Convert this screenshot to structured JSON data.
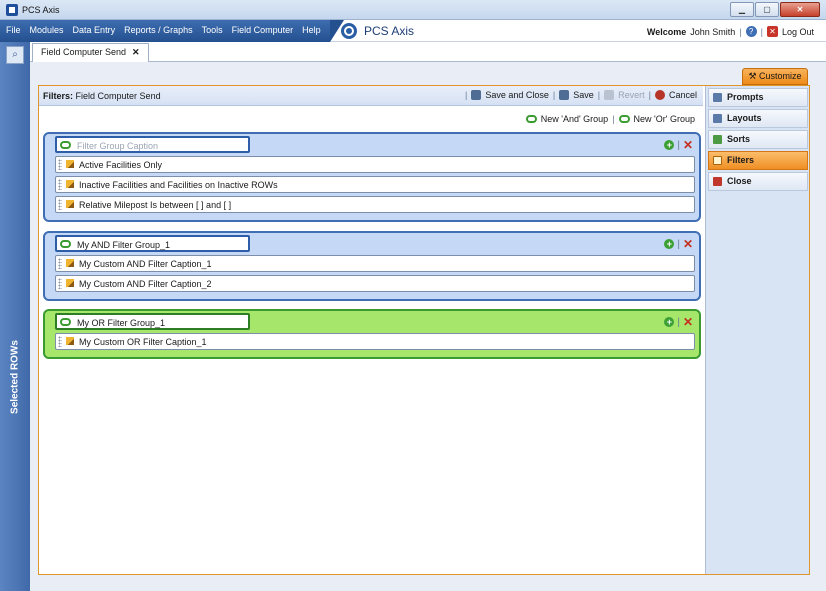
{
  "window": {
    "title": "PCS Axis",
    "minimize": "▁",
    "maximize": "▢",
    "close": "✕"
  },
  "menu": {
    "items": [
      "File",
      "Modules",
      "Data Entry",
      "Reports / Graphs",
      "Tools",
      "Field Computer",
      "Help"
    ],
    "logo_text": "PCS Axis",
    "welcome": "Welcome",
    "user_name": "John Smith",
    "logout": "Log Out"
  },
  "left_strip": {
    "label": "Selected ROWs"
  },
  "tabs": [
    {
      "label": "Field Computer Send",
      "close": "✕"
    }
  ],
  "customize_label": "Customize",
  "filters_header": {
    "label": "Filters:",
    "name": "Field Computer Send",
    "save_and_close": "Save and Close",
    "save": "Save",
    "revert": "Revert",
    "cancel": "Cancel"
  },
  "group_links": {
    "new_and": "New 'And' Group",
    "new_or": "New 'Or' Group"
  },
  "groups": [
    {
      "caption": "",
      "placeholder": "Filter Group Caption",
      "type": "and",
      "rows": [
        "Active Facilities Only",
        "Inactive Facilities and Facilities on Inactive ROWs",
        "Relative Milepost Is between [            ] and [            ]"
      ]
    },
    {
      "caption": "My AND Filter Group_1",
      "type": "and",
      "rows": [
        "My Custom AND Filter Caption_1",
        "My Custom AND Filter Caption_2"
      ]
    },
    {
      "caption": "My OR Filter Group_1",
      "type": "or",
      "rows": [
        "My Custom OR Filter Caption_1"
      ]
    }
  ],
  "sidebar": {
    "items": [
      {
        "label": "Prompts",
        "active": false
      },
      {
        "label": "Layouts",
        "active": false
      },
      {
        "label": "Sorts",
        "active": false
      },
      {
        "label": "Filters",
        "active": true
      },
      {
        "label": "Close",
        "active": false
      }
    ]
  },
  "colors": {
    "accent": "#ee8a1a",
    "and_group": "#c5d9f6",
    "or_group": "#a6e66a"
  }
}
